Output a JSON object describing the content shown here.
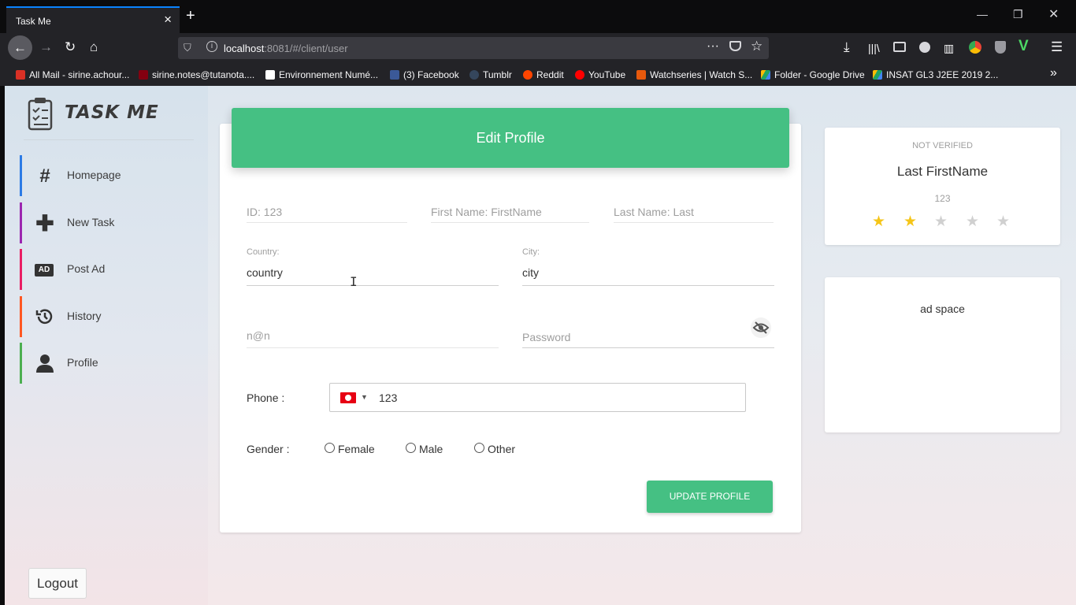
{
  "browser": {
    "tab_title": "Task Me",
    "url_host": "localhost",
    "url_rest": ":8081/#/client/user",
    "bookmarks": [
      {
        "label": "All Mail - sirine.achour...",
        "color": "#d93025"
      },
      {
        "label": "sirine.notes@tutanota....",
        "color": "#840010"
      },
      {
        "label": "Environnement Numé...",
        "color": "#ffffff"
      },
      {
        "label": "(3) Facebook",
        "color": "#3b5998"
      },
      {
        "label": "Tumblr",
        "color": "#35465c"
      },
      {
        "label": "Reddit",
        "color": "#ff4500"
      },
      {
        "label": "YouTube",
        "color": "#ff0000"
      },
      {
        "label": "Watchseries | Watch S...",
        "color": "#e8590c"
      },
      {
        "label": "Folder - Google Drive",
        "color": "#1fa463"
      },
      {
        "label": "INSAT GL3 J2EE 2019 2...",
        "color": "#4285f4"
      }
    ]
  },
  "sidebar": {
    "brand": "TASK ME",
    "items": [
      {
        "label": "Homepage",
        "icon": "hash-icon",
        "color": "#2c7be5"
      },
      {
        "label": "New Task",
        "icon": "plus-icon",
        "color": "#9c27b0"
      },
      {
        "label": "Post Ad",
        "icon": "ad-icon",
        "color": "#e91e63"
      },
      {
        "label": "History",
        "icon": "history-icon",
        "color": "#ff5722"
      },
      {
        "label": "Profile",
        "icon": "user-icon",
        "color": "#4caf50"
      }
    ],
    "logout": "Logout"
  },
  "form": {
    "title": "Edit Profile",
    "id_placeholder": "ID: 123",
    "firstname_placeholder": "First Name: FirstName",
    "lastname_placeholder": "Last Name: Last",
    "country_label": "Country:",
    "country_value": "country",
    "city_label": "City:",
    "city_value": "city",
    "email_placeholder": "n@n",
    "password_placeholder": "Password",
    "phone_label": "Phone :",
    "phone_value": "123",
    "gender_label": "Gender :",
    "gender_options": [
      "Female",
      "Male",
      "Other"
    ],
    "submit": "UPDATE PROFILE"
  },
  "profile_card": {
    "status": "NOT VERIFIED",
    "name": "Last FirstName",
    "id": "123",
    "rating": 2,
    "rating_max": 5,
    "star_on_color": "#f5c518",
    "star_off_color": "#d0d0d0"
  },
  "ad": {
    "text": "ad space"
  },
  "colors": {
    "accent": "#45c083"
  }
}
